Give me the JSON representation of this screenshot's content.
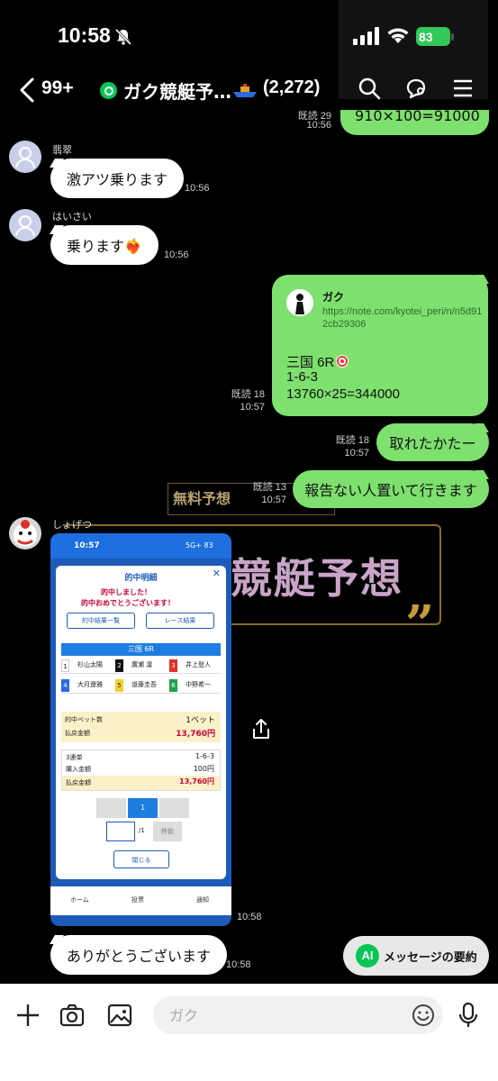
{
  "status": {
    "time": "10:58",
    "battery": "83"
  },
  "header": {
    "back_count": "99+",
    "title": "ガク競艇予…",
    "members": "(2,272)"
  },
  "background": {
    "tag": "無料予想",
    "big": "競艇予想"
  },
  "messages": [
    {
      "sender": "翡翠",
      "text": "激アツ乗ります",
      "time": "10:56"
    },
    {
      "sender": "はいさい",
      "text": "乗ります❤️‍🔥",
      "time": "10:56"
    },
    {
      "link": {
        "name": "ガク",
        "url": "https://note.com/kyotei_peri/n/n5d912cb29306"
      },
      "lines": [
        "三国 6R",
        "1-6-3",
        "13760×25=344000"
      ],
      "read": "既読 18",
      "time": "10:57"
    },
    {
      "text": "取れたかたー",
      "read": "既読 18",
      "time": "10:57"
    },
    {
      "text": "報告ない人置いて行きます",
      "read": "既読 13",
      "time": "10:57"
    },
    {
      "sender": "しょげつ",
      "time": "10:58"
    },
    {
      "text": "ありがとうございます",
      "time": "10:58"
    }
  ],
  "top_partial": {
    "text": "910×100=91000",
    "read": "既読 29",
    "time": "10:56"
  },
  "screenshot": {
    "time": "10:57",
    "signal": "5G+ 83",
    "title": "的中明細",
    "close": "✕",
    "close_sub": "閉じる",
    "msg1": "的中しました！",
    "msg2": "的中おめでとうございます！",
    "btn1": "的中結果一覧",
    "btn2": "レース結果",
    "race": "三国 6R",
    "racers": [
      {
        "lane": "1",
        "name": "杉山太陽",
        "color": "#ffffff",
        "fg": "#000"
      },
      {
        "lane": "2",
        "name": "廣瀬 凜",
        "color": "#111111",
        "fg": "#fff"
      },
      {
        "lane": "3",
        "name": "井上登人",
        "color": "#e0302a",
        "fg": "#fff"
      },
      {
        "lane": "4",
        "name": "大月遼雅",
        "color": "#2a6be0",
        "fg": "#fff"
      },
      {
        "lane": "5",
        "name": "道藤圭吾",
        "color": "#f2d22a",
        "fg": "#000"
      },
      {
        "lane": "6",
        "name": "中野希一",
        "color": "#1fa14a",
        "fg": "#fff"
      }
    ],
    "bet_label": "的中ベット数",
    "bet_value": "1ベット",
    "pay_label": "払戻金額",
    "pay_value": "13,760円",
    "bet_type": "3連単",
    "combo": "1-6-3",
    "buy_label": "購入金額",
    "buy_value": "100円",
    "refund_label": "払戻金額",
    "refund_value": "13,760円",
    "page": "1",
    "page_of": "/1",
    "move": "移動",
    "close_btn": "閉じる",
    "tabs": [
      "ホーム",
      "投票",
      "通知"
    ]
  },
  "ai_button": {
    "badge": "AI",
    "label": "メッセージの要約"
  },
  "input": {
    "placeholder": "ガク"
  }
}
